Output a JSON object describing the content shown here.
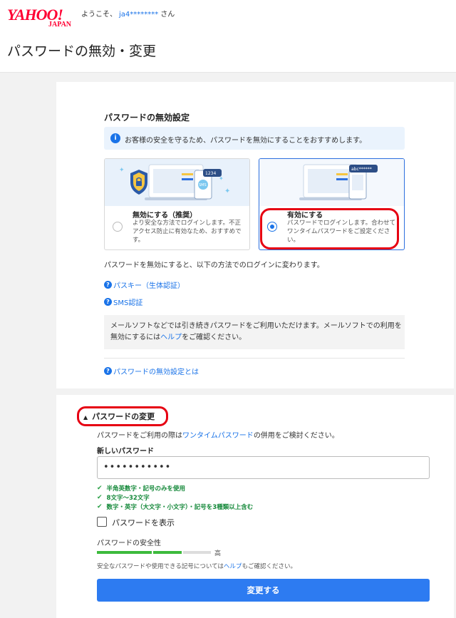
{
  "header": {
    "logo_main": "YAHOO!",
    "logo_sub": "JAPAN",
    "welcome_prefix": "ようこそ、",
    "username": "ja4********",
    "welcome_suffix": "さん",
    "page_title": "パスワードの無効・変更"
  },
  "disable_section": {
    "title": "パスワードの無効設定",
    "info": "お客様の安全を守るため、パスワードを無効にすることをおすすめします。",
    "options": [
      {
        "title": "無効にする（推奨）",
        "desc": "より安全な方法でログインします。不正アクセス防止に有効なため、おすすめです。",
        "selected": false,
        "illus_badge": "1234",
        "illus_chip": "SMS"
      },
      {
        "title": "有効にする",
        "desc": "パスワードでログインします。合わせてワンタイムパスワードをご設定ください。",
        "selected": true,
        "illus_badge": "abc******"
      }
    ],
    "body_text": "パスワードを無効にすると、以下の方法でのログインに変わります。",
    "links": [
      "パスキー（生体認証）",
      "SMS認証"
    ],
    "note_before": "メールソフトなどでは引き続きパスワードをご利用いただけます。メールソフトでの利用を無効にするには",
    "note_link": "ヘルプ",
    "note_after": "をご確認ください。",
    "about_link": "パスワードの無効設定とは"
  },
  "change_section": {
    "title": "パスワードの変更",
    "hint_before": "パスワードをご利用の際は",
    "hint_link": "ワンタイムパスワード",
    "hint_after": "の併用をご検討ください。",
    "new_pw_label": "新しいパスワード",
    "pw_value": "•••••••••••",
    "requirements": [
      "半角英数字・記号のみを使用",
      "8文字〜32文字",
      "数字・英字（大文字・小文字）・記号を3種類以上含む"
    ],
    "show_pw_label": "パスワードを表示",
    "strength_label": "パスワードの安全性",
    "strength_word": "高",
    "strength_level": 0.75,
    "safe_before": "安全なパスワードや使用できる記号については",
    "safe_link": "ヘルプ",
    "safe_after": "もご確認ください。",
    "submit_label": "変更する"
  },
  "colors": {
    "brand": "#ff0033",
    "accent": "#1a73e8",
    "highlight": "#e60012",
    "ok": "#15893a"
  }
}
